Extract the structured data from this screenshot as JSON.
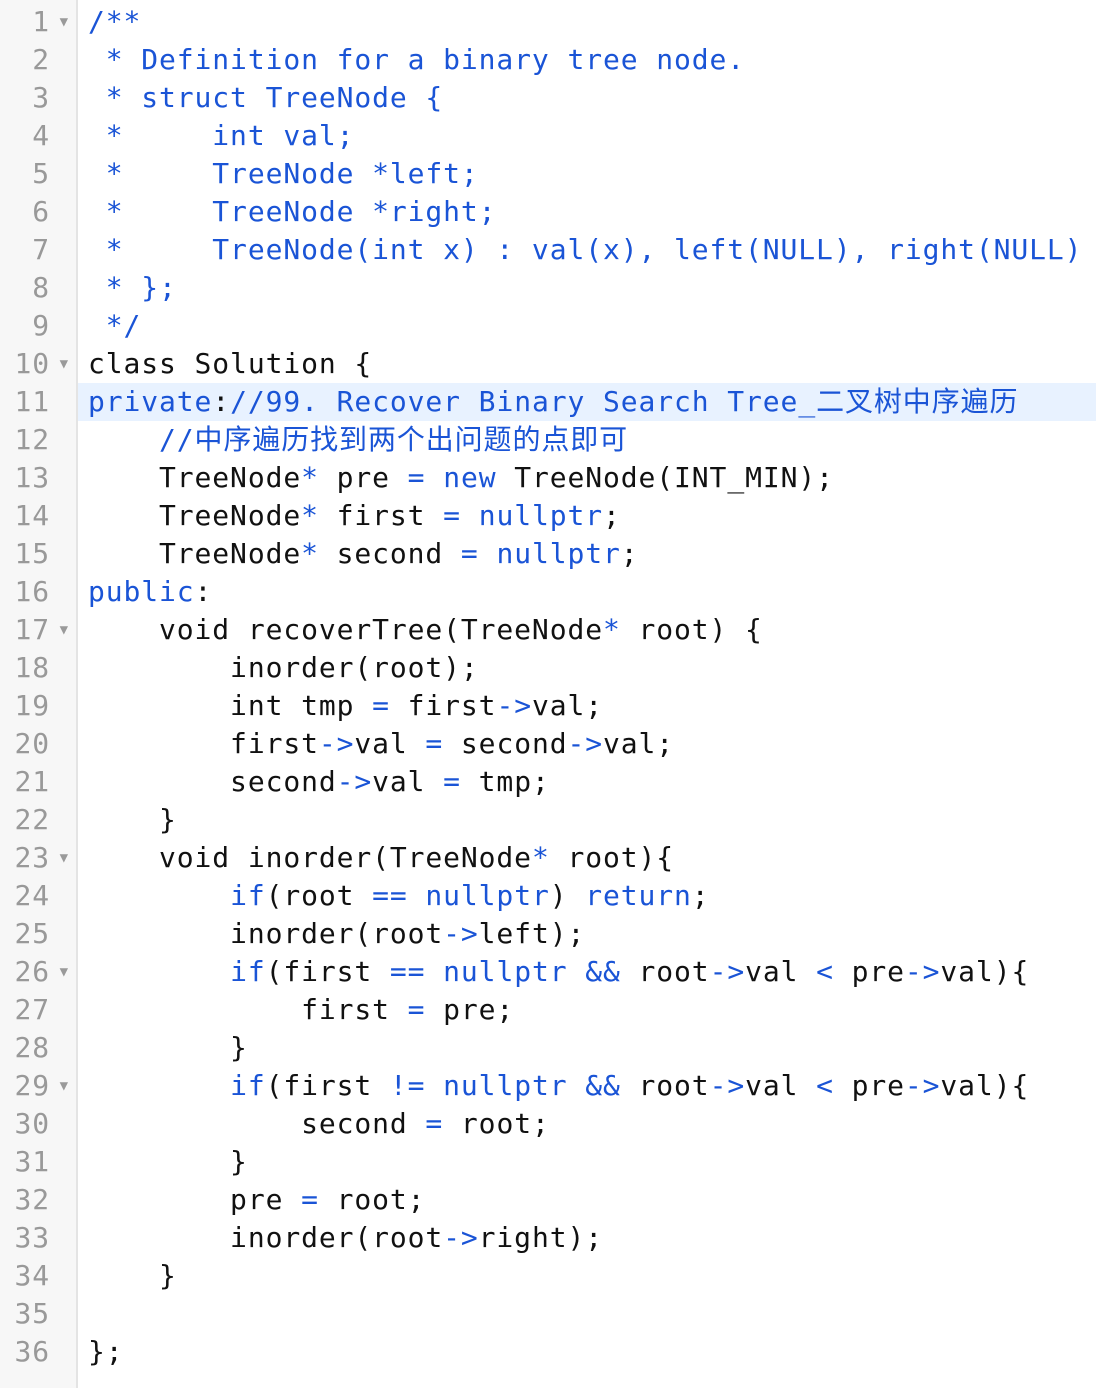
{
  "editor": {
    "active_line": 11,
    "colors": {
      "comment": "#1a54d6",
      "keyword": "#1a54d6",
      "operator": "#1a54d6",
      "plain": "#111111",
      "line_number": "#999999",
      "gutter_background": "#f7f7f7",
      "active_line_background": "#e8f2ff"
    },
    "fold_icon": "fold-triangle-down-icon",
    "lines": [
      {
        "number": "1",
        "foldable": true,
        "tokens": [
          {
            "t": "c",
            "v": "/**"
          }
        ]
      },
      {
        "number": "2",
        "foldable": false,
        "tokens": [
          {
            "t": "c",
            "v": " * Definition for a binary tree node."
          }
        ]
      },
      {
        "number": "3",
        "foldable": false,
        "tokens": [
          {
            "t": "c",
            "v": " * struct TreeNode {"
          }
        ]
      },
      {
        "number": "4",
        "foldable": false,
        "tokens": [
          {
            "t": "c",
            "v": " *     int val;"
          }
        ]
      },
      {
        "number": "5",
        "foldable": false,
        "tokens": [
          {
            "t": "c",
            "v": " *     TreeNode *left;"
          }
        ]
      },
      {
        "number": "6",
        "foldable": false,
        "tokens": [
          {
            "t": "c",
            "v": " *     TreeNode *right;"
          }
        ]
      },
      {
        "number": "7",
        "foldable": false,
        "tokens": [
          {
            "t": "c",
            "v": " *     TreeNode(int x) : val(x), left(NULL), right(NULL) {}"
          }
        ]
      },
      {
        "number": "8",
        "foldable": false,
        "tokens": [
          {
            "t": "c",
            "v": " * };"
          }
        ]
      },
      {
        "number": "9",
        "foldable": false,
        "tokens": [
          {
            "t": "c",
            "v": " */"
          }
        ]
      },
      {
        "number": "10",
        "foldable": true,
        "tokens": [
          {
            "t": "p",
            "v": "class Solution {"
          }
        ]
      },
      {
        "number": "11",
        "foldable": false,
        "tokens": [
          {
            "t": "k",
            "v": "private"
          },
          {
            "t": "p",
            "v": ":"
          },
          {
            "t": "c",
            "v": "//99. Recover Binary Search Tree_二叉树中序遍历"
          }
        ]
      },
      {
        "number": "12",
        "foldable": false,
        "tokens": [
          {
            "t": "p",
            "v": "    "
          },
          {
            "t": "c",
            "v": "//中序遍历找到两个出问题的点即可"
          }
        ]
      },
      {
        "number": "13",
        "foldable": false,
        "tokens": [
          {
            "t": "p",
            "v": "    TreeNode"
          },
          {
            "t": "o",
            "v": "*"
          },
          {
            "t": "p",
            "v": " pre "
          },
          {
            "t": "o",
            "v": "="
          },
          {
            "t": "p",
            "v": " "
          },
          {
            "t": "k",
            "v": "new"
          },
          {
            "t": "p",
            "v": " TreeNode(INT_MIN);"
          }
        ]
      },
      {
        "number": "14",
        "foldable": false,
        "tokens": [
          {
            "t": "p",
            "v": "    TreeNode"
          },
          {
            "t": "o",
            "v": "*"
          },
          {
            "t": "p",
            "v": " first "
          },
          {
            "t": "o",
            "v": "="
          },
          {
            "t": "p",
            "v": " "
          },
          {
            "t": "k",
            "v": "nullptr"
          },
          {
            "t": "p",
            "v": ";"
          }
        ]
      },
      {
        "number": "15",
        "foldable": false,
        "tokens": [
          {
            "t": "p",
            "v": "    TreeNode"
          },
          {
            "t": "o",
            "v": "*"
          },
          {
            "t": "p",
            "v": " second "
          },
          {
            "t": "o",
            "v": "="
          },
          {
            "t": "p",
            "v": " "
          },
          {
            "t": "k",
            "v": "nullptr"
          },
          {
            "t": "p",
            "v": ";"
          }
        ]
      },
      {
        "number": "16",
        "foldable": false,
        "tokens": [
          {
            "t": "k",
            "v": "public"
          },
          {
            "t": "p",
            "v": ":"
          }
        ]
      },
      {
        "number": "17",
        "foldable": true,
        "tokens": [
          {
            "t": "p",
            "v": "    void recoverTree(TreeNode"
          },
          {
            "t": "o",
            "v": "*"
          },
          {
            "t": "p",
            "v": " root) {"
          }
        ]
      },
      {
        "number": "18",
        "foldable": false,
        "tokens": [
          {
            "t": "p",
            "v": "        inorder(root);"
          }
        ]
      },
      {
        "number": "19",
        "foldable": false,
        "tokens": [
          {
            "t": "p",
            "v": "        int tmp "
          },
          {
            "t": "o",
            "v": "="
          },
          {
            "t": "p",
            "v": " first"
          },
          {
            "t": "o",
            "v": "->"
          },
          {
            "t": "p",
            "v": "val;"
          }
        ]
      },
      {
        "number": "20",
        "foldable": false,
        "tokens": [
          {
            "t": "p",
            "v": "        first"
          },
          {
            "t": "o",
            "v": "->"
          },
          {
            "t": "p",
            "v": "val "
          },
          {
            "t": "o",
            "v": "="
          },
          {
            "t": "p",
            "v": " second"
          },
          {
            "t": "o",
            "v": "->"
          },
          {
            "t": "p",
            "v": "val;"
          }
        ]
      },
      {
        "number": "21",
        "foldable": false,
        "tokens": [
          {
            "t": "p",
            "v": "        second"
          },
          {
            "t": "o",
            "v": "->"
          },
          {
            "t": "p",
            "v": "val "
          },
          {
            "t": "o",
            "v": "="
          },
          {
            "t": "p",
            "v": " tmp;"
          }
        ]
      },
      {
        "number": "22",
        "foldable": false,
        "tokens": [
          {
            "t": "p",
            "v": "    }"
          }
        ]
      },
      {
        "number": "23",
        "foldable": true,
        "tokens": [
          {
            "t": "p",
            "v": "    void inorder(TreeNode"
          },
          {
            "t": "o",
            "v": "*"
          },
          {
            "t": "p",
            "v": " root){"
          }
        ]
      },
      {
        "number": "24",
        "foldable": false,
        "tokens": [
          {
            "t": "p",
            "v": "        "
          },
          {
            "t": "k",
            "v": "if"
          },
          {
            "t": "p",
            "v": "(root "
          },
          {
            "t": "o",
            "v": "=="
          },
          {
            "t": "p",
            "v": " "
          },
          {
            "t": "k",
            "v": "nullptr"
          },
          {
            "t": "p",
            "v": ") "
          },
          {
            "t": "k",
            "v": "return"
          },
          {
            "t": "p",
            "v": ";"
          }
        ]
      },
      {
        "number": "25",
        "foldable": false,
        "tokens": [
          {
            "t": "p",
            "v": "        inorder(root"
          },
          {
            "t": "o",
            "v": "->"
          },
          {
            "t": "p",
            "v": "left);"
          }
        ]
      },
      {
        "number": "26",
        "foldable": true,
        "tokens": [
          {
            "t": "p",
            "v": "        "
          },
          {
            "t": "k",
            "v": "if"
          },
          {
            "t": "p",
            "v": "(first "
          },
          {
            "t": "o",
            "v": "=="
          },
          {
            "t": "p",
            "v": " "
          },
          {
            "t": "k",
            "v": "nullptr"
          },
          {
            "t": "p",
            "v": " "
          },
          {
            "t": "o",
            "v": "&&"
          },
          {
            "t": "p",
            "v": " root"
          },
          {
            "t": "o",
            "v": "->"
          },
          {
            "t": "p",
            "v": "val "
          },
          {
            "t": "o",
            "v": "<"
          },
          {
            "t": "p",
            "v": " pre"
          },
          {
            "t": "o",
            "v": "->"
          },
          {
            "t": "p",
            "v": "val){"
          }
        ]
      },
      {
        "number": "27",
        "foldable": false,
        "tokens": [
          {
            "t": "p",
            "v": "            first "
          },
          {
            "t": "o",
            "v": "="
          },
          {
            "t": "p",
            "v": " pre;"
          }
        ]
      },
      {
        "number": "28",
        "foldable": false,
        "tokens": [
          {
            "t": "p",
            "v": "        }"
          }
        ]
      },
      {
        "number": "29",
        "foldable": true,
        "tokens": [
          {
            "t": "p",
            "v": "        "
          },
          {
            "t": "k",
            "v": "if"
          },
          {
            "t": "p",
            "v": "(first "
          },
          {
            "t": "o",
            "v": "!="
          },
          {
            "t": "p",
            "v": " "
          },
          {
            "t": "k",
            "v": "nullptr"
          },
          {
            "t": "p",
            "v": " "
          },
          {
            "t": "o",
            "v": "&&"
          },
          {
            "t": "p",
            "v": " root"
          },
          {
            "t": "o",
            "v": "->"
          },
          {
            "t": "p",
            "v": "val "
          },
          {
            "t": "o",
            "v": "<"
          },
          {
            "t": "p",
            "v": " pre"
          },
          {
            "t": "o",
            "v": "->"
          },
          {
            "t": "p",
            "v": "val){"
          }
        ]
      },
      {
        "number": "30",
        "foldable": false,
        "tokens": [
          {
            "t": "p",
            "v": "            second "
          },
          {
            "t": "o",
            "v": "="
          },
          {
            "t": "p",
            "v": " root;"
          }
        ]
      },
      {
        "number": "31",
        "foldable": false,
        "tokens": [
          {
            "t": "p",
            "v": "        }"
          }
        ]
      },
      {
        "number": "32",
        "foldable": false,
        "tokens": [
          {
            "t": "p",
            "v": "        pre "
          },
          {
            "t": "o",
            "v": "="
          },
          {
            "t": "p",
            "v": " root;"
          }
        ]
      },
      {
        "number": "33",
        "foldable": false,
        "tokens": [
          {
            "t": "p",
            "v": "        inorder(root"
          },
          {
            "t": "o",
            "v": "->"
          },
          {
            "t": "p",
            "v": "right);"
          }
        ]
      },
      {
        "number": "34",
        "foldable": false,
        "tokens": [
          {
            "t": "p",
            "v": "    }"
          }
        ]
      },
      {
        "number": "35",
        "foldable": false,
        "tokens": []
      },
      {
        "number": "36",
        "foldable": false,
        "tokens": [
          {
            "t": "p",
            "v": "};"
          }
        ]
      }
    ]
  }
}
